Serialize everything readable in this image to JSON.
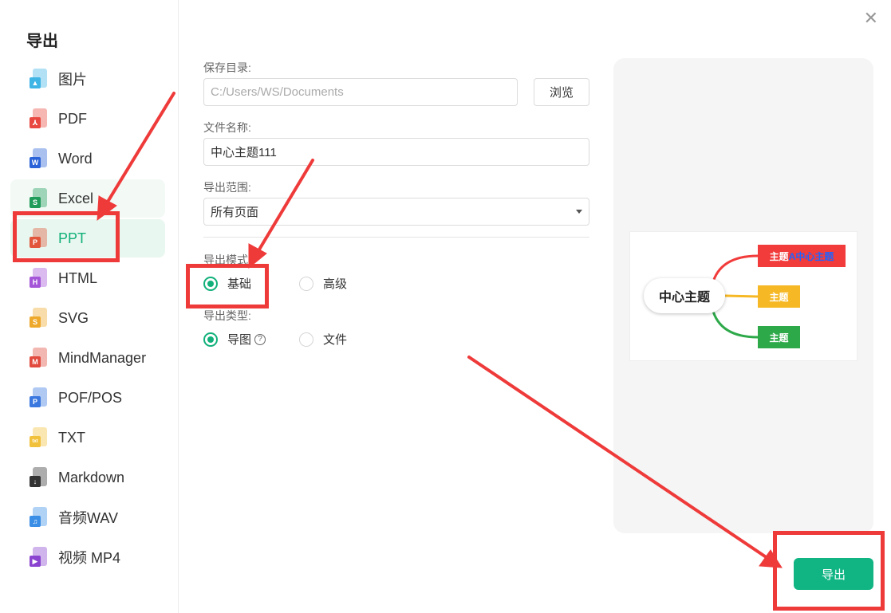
{
  "sidebar": {
    "title": "导出",
    "items": [
      {
        "label": "图片",
        "icon": "image-file-icon",
        "color": "#3fb5e6",
        "glyph": "▲"
      },
      {
        "label": "PDF",
        "icon": "pdf-file-icon",
        "color": "#e8483f",
        "glyph": "⅄"
      },
      {
        "label": "Word",
        "icon": "word-file-icon",
        "color": "#2b64d8",
        "glyph": "W"
      },
      {
        "label": "Excel",
        "icon": "excel-file-icon",
        "color": "#1f9b5a",
        "glyph": "S"
      },
      {
        "label": "PPT",
        "icon": "ppt-file-icon",
        "color": "#e2573b",
        "glyph": "P"
      },
      {
        "label": "HTML",
        "icon": "html-file-icon",
        "color": "#a455d8",
        "glyph": "H"
      },
      {
        "label": "SVG",
        "icon": "svg-file-icon",
        "color": "#eea92b",
        "glyph": "S"
      },
      {
        "label": "MindManager",
        "icon": "mindmanager-file-icon",
        "color": "#e24a3e",
        "glyph": "M"
      },
      {
        "label": "POF/POS",
        "icon": "pof-file-icon",
        "color": "#3a78e0",
        "glyph": "P"
      },
      {
        "label": "TXT",
        "icon": "txt-file-icon",
        "color": "#f2c13c",
        "glyph": "txt"
      },
      {
        "label": "Markdown",
        "icon": "markdown-file-icon",
        "color": "#333333",
        "glyph": "↓"
      },
      {
        "label": "音频WAV",
        "icon": "audio-file-icon",
        "color": "#3a8ee6",
        "glyph": "♫"
      },
      {
        "label": "视频 MP4",
        "icon": "video-file-icon",
        "color": "#8a44d0",
        "glyph": "▶"
      }
    ],
    "active_index": 4,
    "hover_index": 3
  },
  "form": {
    "save_dir_label": "保存目录:",
    "save_dir_value": "C:/Users/WS/Documents",
    "browse_label": "浏览",
    "filename_label": "文件名称:",
    "filename_value": "中心主题111",
    "range_label": "导出范围:",
    "range_value": "所有页面",
    "mode_label": "导出模式:",
    "mode_basic": "基础",
    "mode_advanced": "高级",
    "type_label": "导出类型:",
    "type_map": "导图",
    "type_file": "文件",
    "help_glyph": "?"
  },
  "preview": {
    "center": "中心主题",
    "node1_prefix": "主题",
    "node1_highlight": "A中心主题",
    "node2": "主题",
    "node3": "主题"
  },
  "export_button": "导出",
  "close_glyph": "✕",
  "colors": {
    "accent": "#11b07a",
    "annotation": "#ef3a3a"
  }
}
